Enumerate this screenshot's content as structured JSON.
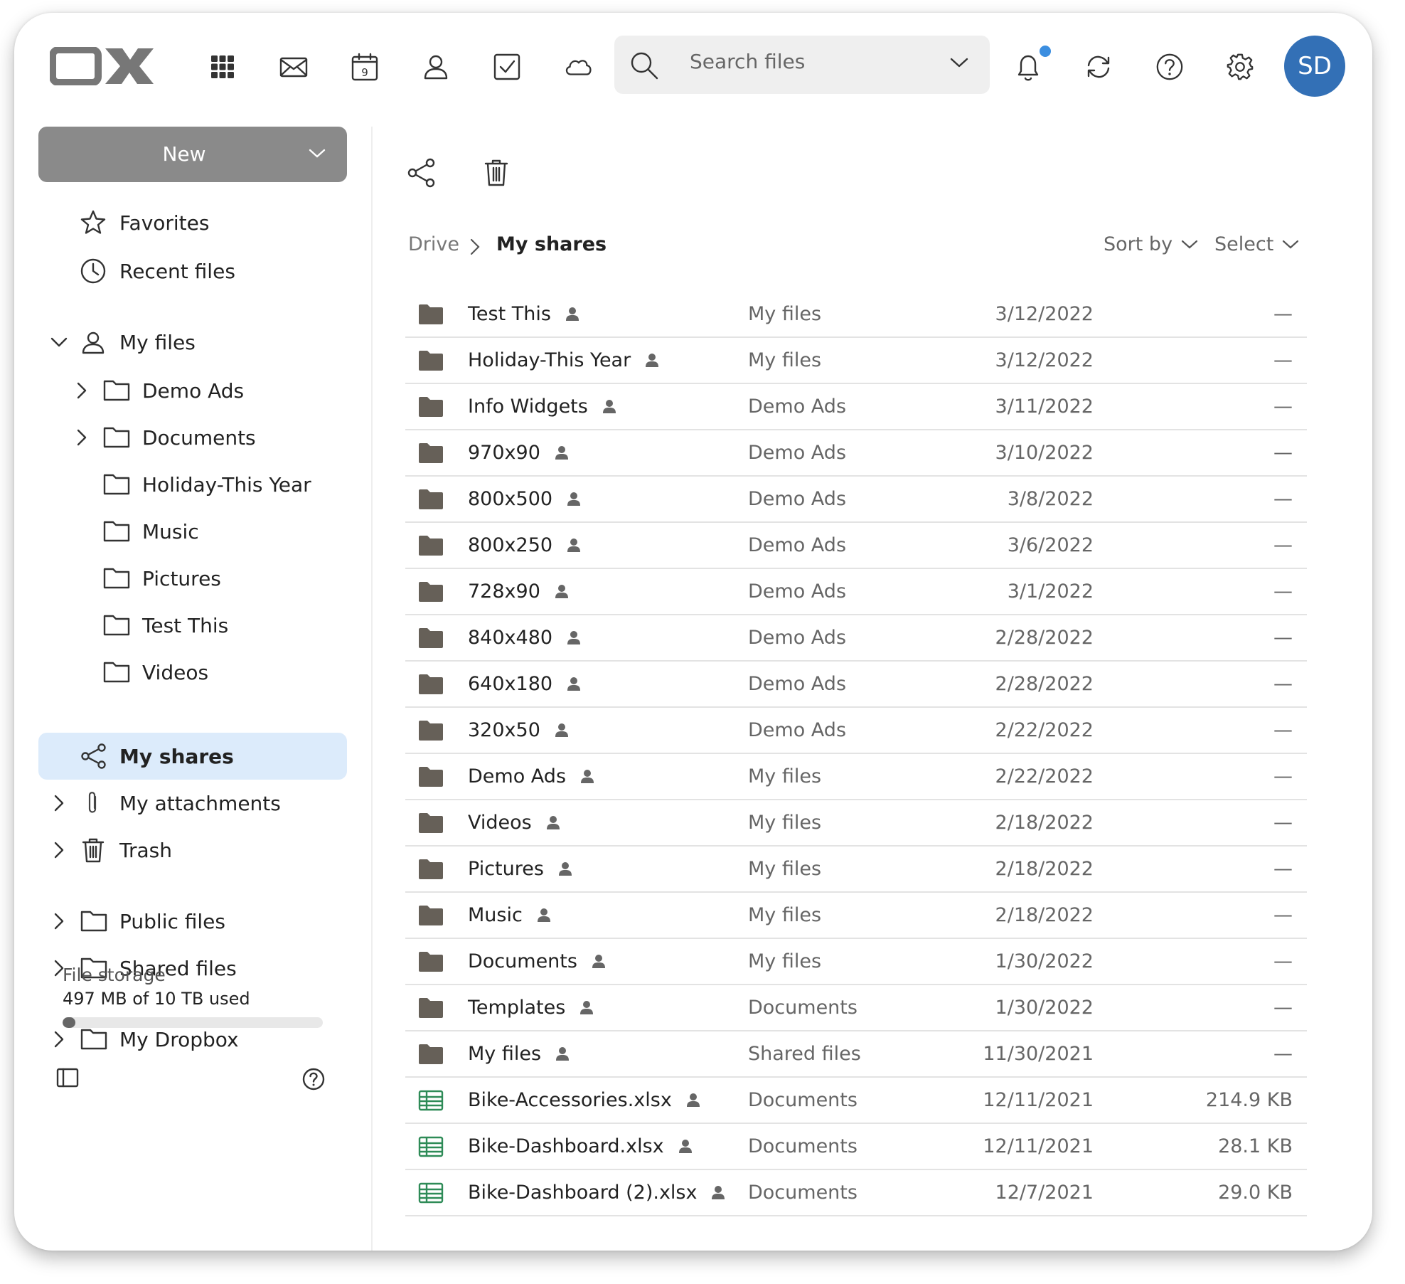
{
  "app": {
    "logo_text": "OX",
    "avatar_initials": "SD"
  },
  "topbar": {
    "apps": [
      "apps-grid-icon",
      "mail-icon",
      "calendar-icon",
      "contacts-icon",
      "tasks-icon",
      "drive-cloud-icon"
    ],
    "calendar_day": "9",
    "search_placeholder": "Search files",
    "right_icons": [
      "bell-icon",
      "refresh-icon",
      "help-icon",
      "settings-icon"
    ]
  },
  "sidebar": {
    "new_label": "New",
    "favorites": "Favorites",
    "recent": "Recent files",
    "my_files": "My files",
    "my_files_children": [
      "Demo Ads",
      "Documents",
      "Holiday-This Year",
      "Music",
      "Pictures",
      "Test This",
      "Videos"
    ],
    "my_shares": "My shares",
    "my_attachments": "My attachments",
    "trash": "Trash",
    "public_files": "Public files",
    "shared_files": "Shared files",
    "my_dropbox": "My Dropbox",
    "storage_title": "File storage",
    "storage_used": "497 MB of 10 TB used",
    "storage_fraction": 0.05
  },
  "breadcrumb": {
    "root": "Drive",
    "current": "My shares"
  },
  "controls": {
    "sort_by": "Sort by",
    "select": "Select"
  },
  "files": [
    {
      "name": "Test This",
      "type": "folder",
      "location": "My files",
      "date": "3/12/2022",
      "size": "—"
    },
    {
      "name": "Holiday-This Year",
      "type": "folder",
      "location": "My files",
      "date": "3/12/2022",
      "size": "—"
    },
    {
      "name": "Info Widgets",
      "type": "folder",
      "location": "Demo Ads",
      "date": "3/11/2022",
      "size": "—"
    },
    {
      "name": "970x90",
      "type": "folder",
      "location": "Demo Ads",
      "date": "3/10/2022",
      "size": "—"
    },
    {
      "name": "800x500",
      "type": "folder",
      "location": "Demo Ads",
      "date": "3/8/2022",
      "size": "—"
    },
    {
      "name": "800x250",
      "type": "folder",
      "location": "Demo Ads",
      "date": "3/6/2022",
      "size": "—"
    },
    {
      "name": "728x90",
      "type": "folder",
      "location": "Demo Ads",
      "date": "3/1/2022",
      "size": "—"
    },
    {
      "name": "840x480",
      "type": "folder",
      "location": "Demo Ads",
      "date": "2/28/2022",
      "size": "—"
    },
    {
      "name": "640x180",
      "type": "folder",
      "location": "Demo Ads",
      "date": "2/28/2022",
      "size": "—"
    },
    {
      "name": "320x50",
      "type": "folder",
      "location": "Demo Ads",
      "date": "2/22/2022",
      "size": "—"
    },
    {
      "name": "Demo Ads",
      "type": "folder",
      "location": "My files",
      "date": "2/22/2022",
      "size": "—"
    },
    {
      "name": "Videos",
      "type": "folder",
      "location": "My files",
      "date": "2/18/2022",
      "size": "—"
    },
    {
      "name": "Pictures",
      "type": "folder",
      "location": "My files",
      "date": "2/18/2022",
      "size": "—"
    },
    {
      "name": "Music",
      "type": "folder",
      "location": "My files",
      "date": "2/18/2022",
      "size": "—"
    },
    {
      "name": "Documents",
      "type": "folder",
      "location": "My files",
      "date": "1/30/2022",
      "size": "—"
    },
    {
      "name": "Templates",
      "type": "folder",
      "location": "Documents",
      "date": "1/30/2022",
      "size": "—"
    },
    {
      "name": "My files",
      "type": "folder",
      "location": "Shared files",
      "date": "11/30/2021",
      "size": "—"
    },
    {
      "name": "Bike-Accessories.xlsx",
      "type": "spreadsheet",
      "location": "Documents",
      "date": "12/11/2021",
      "size": "214.9 KB"
    },
    {
      "name": "Bike-Dashboard.xlsx",
      "type": "spreadsheet",
      "location": "Documents",
      "date": "12/11/2021",
      "size": "28.1 KB"
    },
    {
      "name": "Bike-Dashboard (2).xlsx",
      "type": "spreadsheet",
      "location": "Documents",
      "date": "12/7/2021",
      "size": "29.0 KB"
    }
  ],
  "colors": {
    "accent": "#3370b6",
    "selected_bg": "#dcebfb",
    "new_button": "#8a8a8a",
    "folder": "#666058",
    "spreadsheet": "#2e8b57"
  }
}
